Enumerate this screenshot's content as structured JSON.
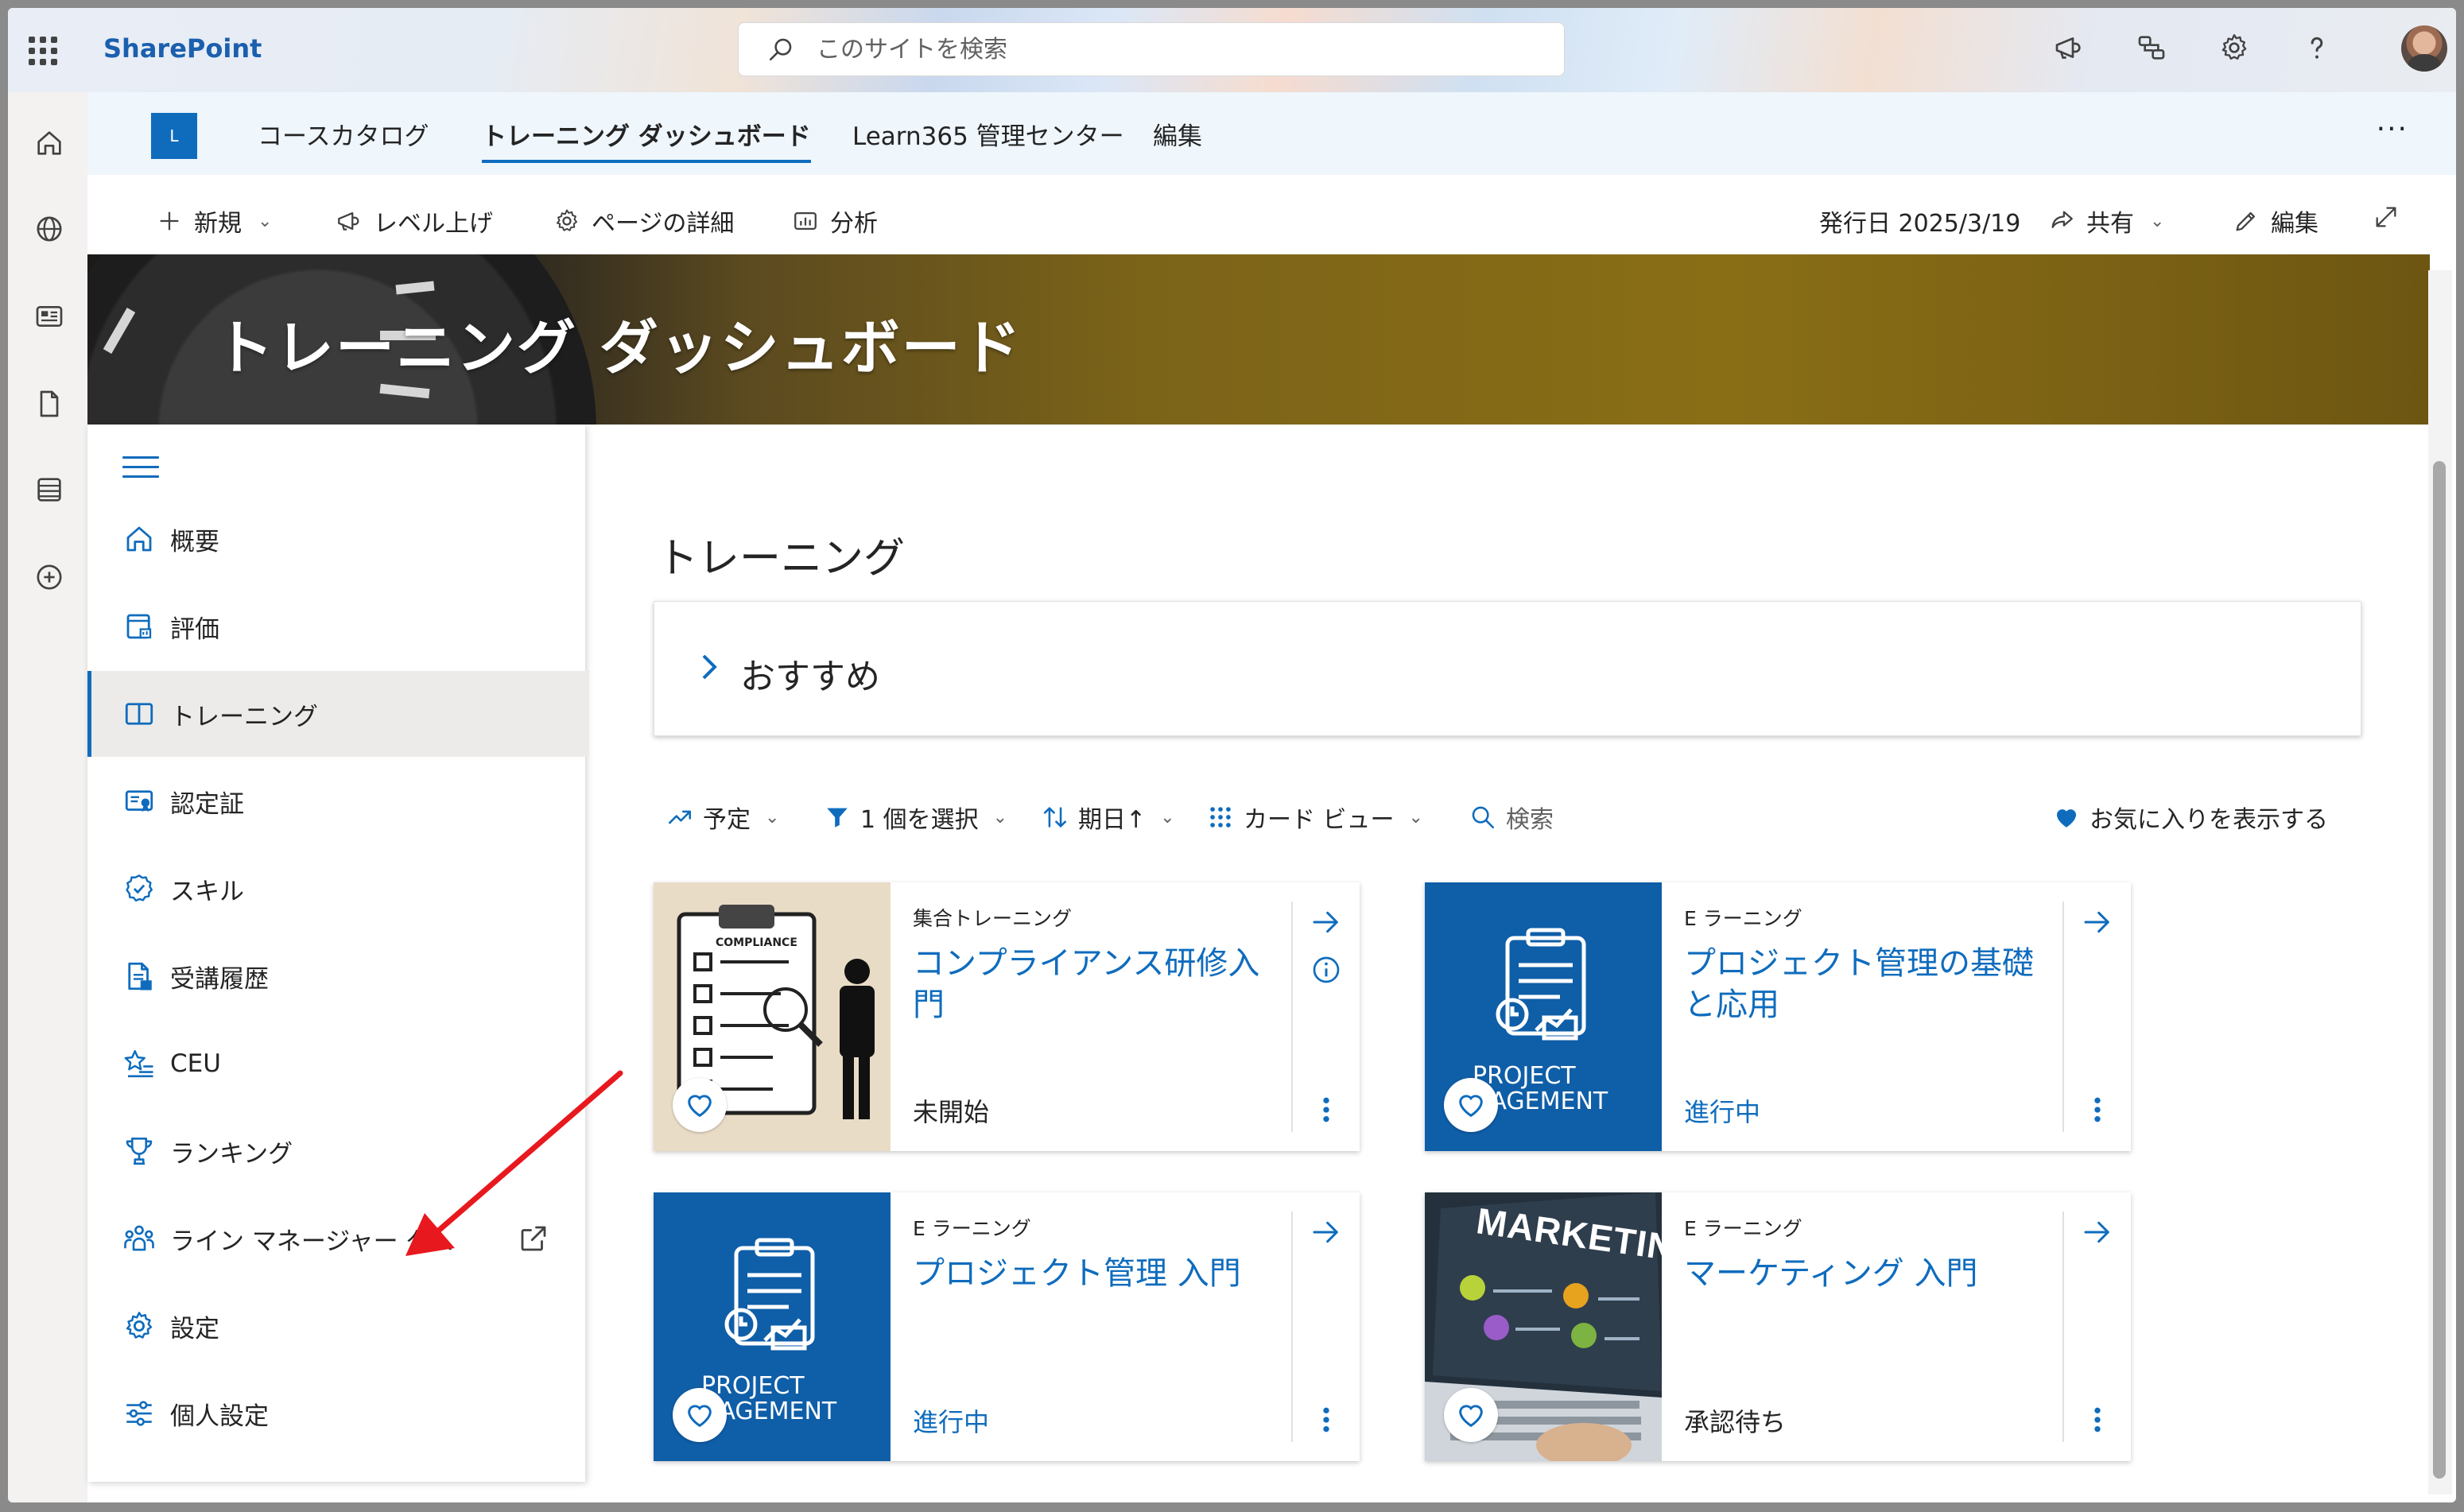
{
  "suitebar": {
    "brand": "SharePoint",
    "search_placeholder": "このサイトを検索"
  },
  "site_nav": {
    "logo_letter": "L",
    "links": [
      "コースカタログ",
      "トレーニング ダッシュボード",
      "Learn365 管理センター",
      "編集"
    ],
    "active_index": 1,
    "more": "···"
  },
  "command_bar": {
    "new": "新規",
    "promote": "レベル上げ",
    "page_details": "ページの詳細",
    "analytics": "分析",
    "published": "発行日 2025/3/19",
    "share": "共有",
    "edit": "編集"
  },
  "hero": {
    "title": "トレーニング ダッシュボード"
  },
  "left_nav": {
    "items": [
      {
        "label": "概要",
        "icon": "home-icon"
      },
      {
        "label": "評価",
        "icon": "assessment-icon"
      },
      {
        "label": "トレーニング",
        "icon": "book-icon",
        "selected": true
      },
      {
        "label": "認定証",
        "icon": "certificate-icon"
      },
      {
        "label": "スキル",
        "icon": "skill-badge-icon"
      },
      {
        "label": "受講履歴",
        "icon": "history-document-icon"
      },
      {
        "label": "CEU",
        "icon": "star-list-icon"
      },
      {
        "label": "ランキング",
        "icon": "trophy-icon"
      },
      {
        "label": "ライン マネージャー ダ...",
        "icon": "people-team-icon",
        "external": true
      },
      {
        "label": "設定",
        "icon": "gear-icon"
      },
      {
        "label": "個人設定",
        "icon": "sliders-icon"
      }
    ]
  },
  "main": {
    "title": "トレーニング",
    "recommended_label": "おすすめ",
    "filters": {
      "scheduled": "予定",
      "selected": "1 個を選択",
      "due": "期日↑",
      "view": "カード ビュー",
      "search": "検索",
      "favorites": "お気に入りを表示する"
    },
    "cards": [
      {
        "type": "集合トレーニング",
        "title": "コンプライアンス研修入門",
        "status": "未開始",
        "status_blue": false,
        "thumb_text": "COMPLIANCE",
        "has_info": true
      },
      {
        "type": "E ラーニング",
        "title": "プロジェクト管理の基礎と応用",
        "status": "進行中",
        "status_blue": true,
        "thumb_text": "PROJECT\nNAGEMENT",
        "has_info": false
      },
      {
        "type": "E ラーニング",
        "title": "プロジェクト管理 入門",
        "status": "進行中",
        "status_blue": true,
        "thumb_text": "PROJECT\nNAGEMENT",
        "has_info": false
      },
      {
        "type": "E ラーニング",
        "title": "マーケティング 入門",
        "status": "承認待ち",
        "status_blue": false,
        "thumb_text": "MARKETING",
        "has_info": false
      }
    ]
  },
  "colors": {
    "accent": "#0f6cbd",
    "annotation": "#e8191e"
  }
}
